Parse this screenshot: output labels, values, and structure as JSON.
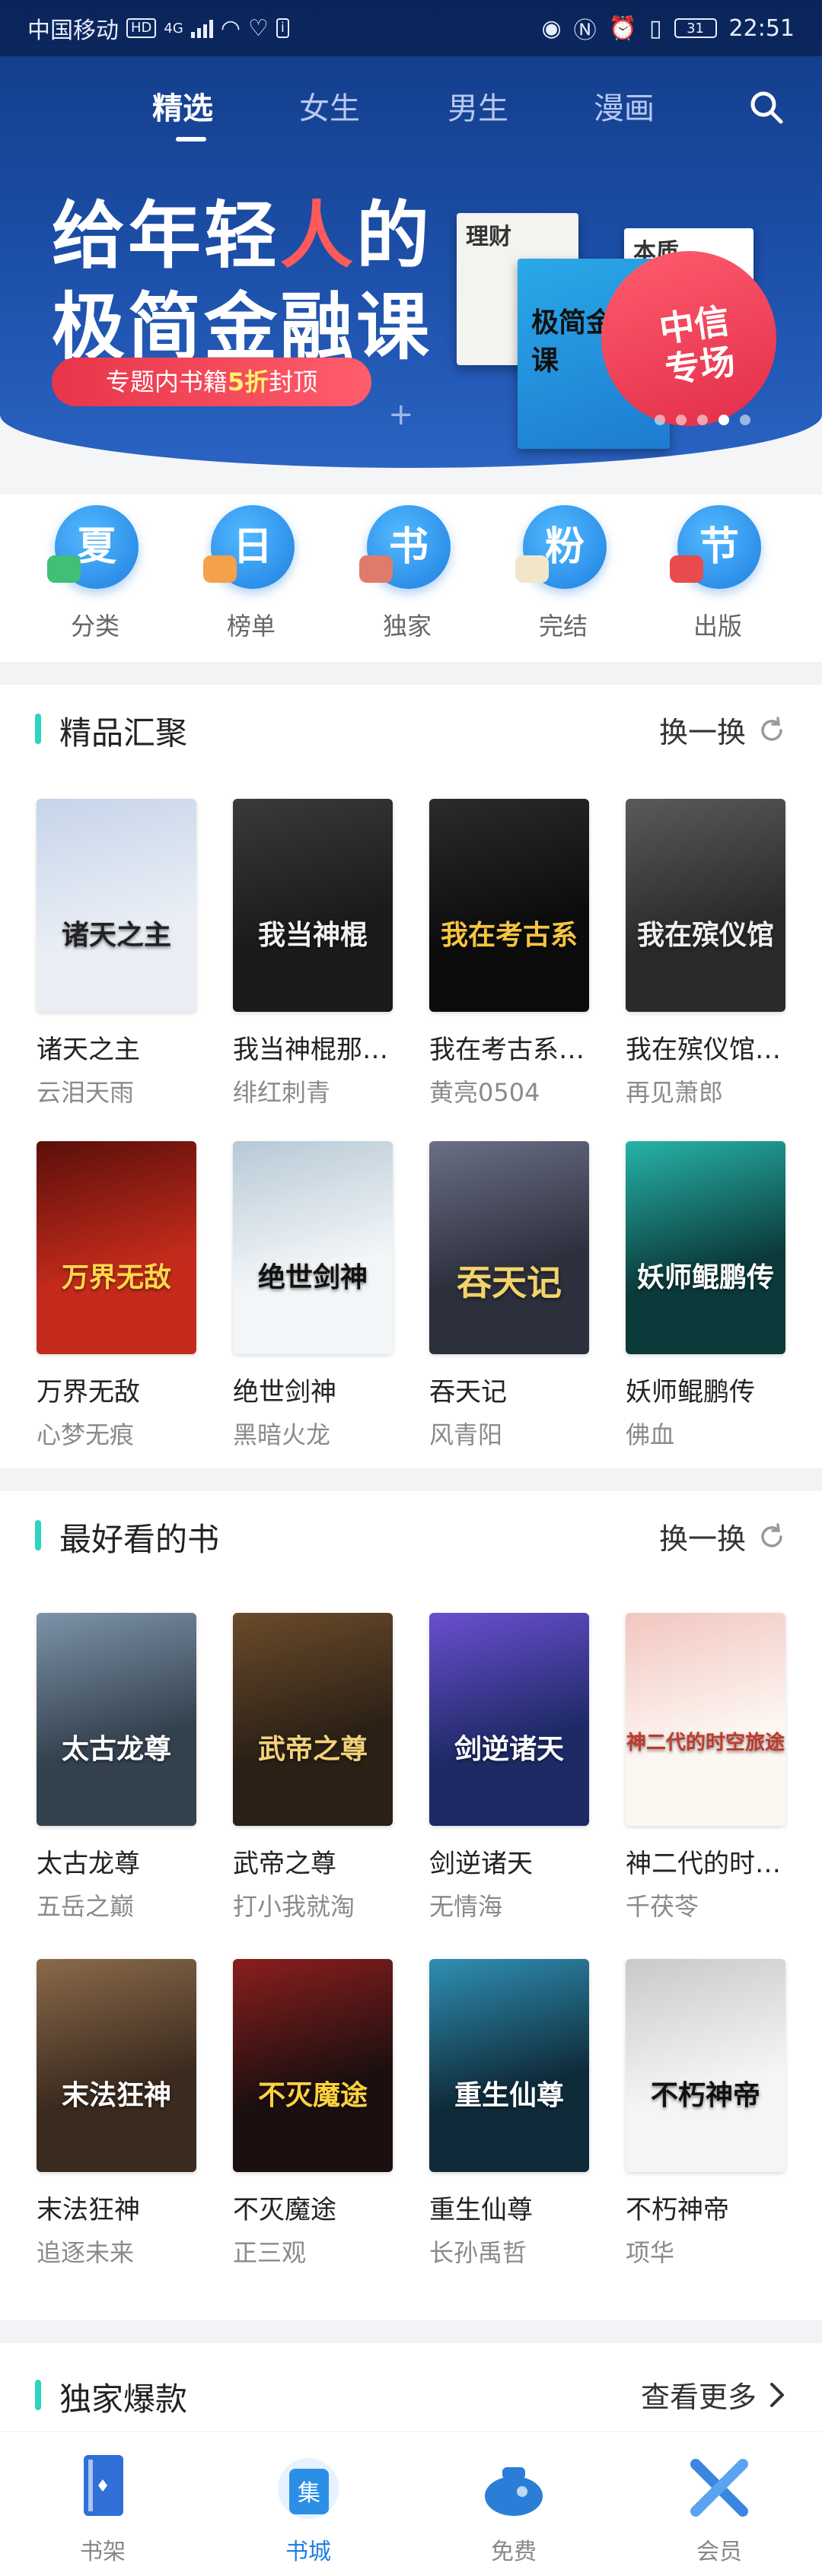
{
  "status_bar": {
    "carrier": "中国移动",
    "hd": "HD",
    "network": "4G",
    "battery": "31",
    "time": "22:51"
  },
  "top_tabs": [
    {
      "label": "精选",
      "active": true
    },
    {
      "label": "女生",
      "active": false
    },
    {
      "label": "男生",
      "active": false
    },
    {
      "label": "漫画",
      "active": false
    }
  ],
  "banner": {
    "line1_a": "给年轻",
    "line1_b": "人",
    "line1_c": "的",
    "line2": "极简金融课",
    "pill_a": "专题内书籍",
    "pill_b": "5折",
    "pill_c": "封顶",
    "book_small_1": "理财",
    "book_small_2": "本质",
    "book_main": "极简金融课",
    "promo_line1": "中信",
    "promo_line2": "专场",
    "dots_total": 5,
    "active_dot": 4
  },
  "categories": [
    {
      "glyph": "夏",
      "label": "分类",
      "deco": "#3fbf77"
    },
    {
      "glyph": "日",
      "label": "榜单",
      "deco": "#f5a04a"
    },
    {
      "glyph": "书",
      "label": "独家",
      "deco": "#e07a6a"
    },
    {
      "glyph": "粉",
      "label": "完结",
      "deco": "#f3e6c8"
    },
    {
      "glyph": "节",
      "label": "出版",
      "deco": "#e84b4b"
    }
  ],
  "section1": {
    "title": "精品汇聚",
    "action": "换一换",
    "books": [
      {
        "title": "诸天之主",
        "author": "云泪天雨",
        "cover_text": "诸天之主",
        "bg": "#e9eef5",
        "fg": "#222",
        "accent": "#c6d4ea"
      },
      {
        "title": "我当神棍那…",
        "author": "绯红刺青",
        "cover_text": "我当神棍",
        "bg": "#1a1a1a",
        "fg": "#f2f2f2",
        "accent": "#3a3a3a"
      },
      {
        "title": "我在考古系…",
        "author": "黄亮0504",
        "cover_text": "我在考古系",
        "bg": "#0c0c0c",
        "fg": "#f5c542",
        "accent": "#2b2b2b"
      },
      {
        "title": "我在殡仪馆…",
        "author": "再见萧郎",
        "cover_text": "我在殡仪馆",
        "bg": "#2a2a2a",
        "fg": "#f0f0f0",
        "accent": "#5a5a5a"
      },
      {
        "title": "万界无敌",
        "author": "心梦无痕",
        "cover_text": "万界无敌",
        "bg": "#c42b1c",
        "fg": "#ffd84a",
        "accent": "#5a0f0a"
      },
      {
        "title": "绝世剑神",
        "author": "黑暗火龙",
        "cover_text": "绝世剑神",
        "bg": "#f3f6f8",
        "fg": "#111",
        "accent": "#b7c9d6"
      },
      {
        "title": "吞天记",
        "author": "风青阳",
        "cover_text": "吞天记",
        "bg": "#2c2f3c",
        "fg": "#f2d36b",
        "accent": "#6b6f86"
      },
      {
        "title": "妖师鲲鹏传",
        "author": "佛血",
        "cover_text": "妖师鲲鹏传",
        "bg": "#0b3a3a",
        "fg": "#ffffff",
        "accent": "#27b3a8"
      }
    ]
  },
  "section2": {
    "title": "最好看的书",
    "action": "换一换",
    "books": [
      {
        "title": "太古龙尊",
        "author": "五岳之巅",
        "cover_text": "太古龙尊",
        "bg": "#34414f",
        "fg": "#ffffff",
        "accent": "#7d93a8"
      },
      {
        "title": "武帝之尊",
        "author": "打小我就淘",
        "cover_text": "武帝之尊",
        "bg": "#2b2016",
        "fg": "#f3d27a",
        "accent": "#6b4b2a"
      },
      {
        "title": "剑逆诸天",
        "author": "无情海",
        "cover_text": "剑逆诸天",
        "bg": "#1e2a66",
        "fg": "#ffffff",
        "accent": "#6a4fd1"
      },
      {
        "title": "神二代的时…",
        "author": "千茯苓",
        "cover_text": "神二代的时空旅途",
        "bg": "#fdf7f2",
        "fg": "#c0392b",
        "accent": "#f2c6c0"
      },
      {
        "title": "末法狂神",
        "author": "追逐未来",
        "cover_text": "末法狂神",
        "bg": "#3b2a1e",
        "fg": "#ffffff",
        "accent": "#8a6a4a"
      },
      {
        "title": "不灭魔途",
        "author": "正三观",
        "cover_text": "不灭魔途",
        "bg": "#1b0f0f",
        "fg": "#ffd23f",
        "accent": "#8b1e1e"
      },
      {
        "title": "重生仙尊",
        "author": "长孙禹哲",
        "cover_text": "重生仙尊",
        "bg": "#0f2b3a",
        "fg": "#ffffff",
        "accent": "#2f8fb3"
      },
      {
        "title": "不朽神帝",
        "author": "项华",
        "cover_text": "不朽神帝",
        "bg": "#f5f5f5",
        "fg": "#111",
        "accent": "#c9c9c9"
      }
    ]
  },
  "section3": {
    "title": "独家爆款",
    "action": "查看更多"
  },
  "bottom_nav": [
    {
      "label": "书架",
      "active": false,
      "icon": "bookshelf-icon",
      "color": "#2f6fd6"
    },
    {
      "label": "书城",
      "active": true,
      "icon": "bookstore-icon",
      "color": "#2b8fe6"
    },
    {
      "label": "免费",
      "active": false,
      "icon": "free-icon",
      "color": "#2a7ed8"
    },
    {
      "label": "会员",
      "active": false,
      "icon": "member-icon",
      "color": "#3b86e0"
    }
  ],
  "colors": {
    "accent": "#2dd4bf",
    "brand_blue": "#1e7fe0",
    "hero_top": "#123a86"
  }
}
